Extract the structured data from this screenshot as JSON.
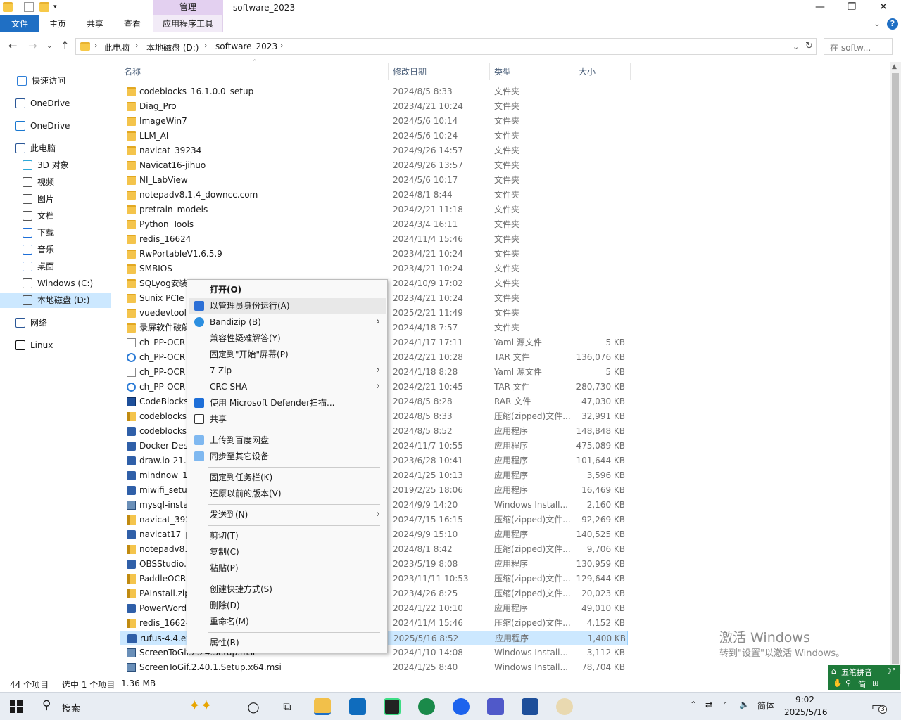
{
  "window": {
    "title": "software_2023",
    "context_tab_header": "管理",
    "controls": {
      "minimize": "—",
      "restore": "❐",
      "close": "✕"
    },
    "help": "?"
  },
  "ribbon": {
    "tabs": [
      "文件",
      "主页",
      "共享",
      "查看"
    ],
    "context_tab": "应用程序工具"
  },
  "address": {
    "crumbs": [
      "此电脑",
      "本地磁盘 (D:)",
      "software_2023"
    ],
    "search_placeholder": "在 softw..."
  },
  "nav": {
    "items": [
      {
        "label": "快速访问",
        "icon": "star-icon"
      },
      {
        "label": "OneDrive",
        "icon": "onedrive-icon"
      },
      {
        "label": "OneDrive",
        "icon": "cloud-icon"
      },
      {
        "label": "此电脑",
        "icon": "computer-icon"
      },
      {
        "label": "3D 对象",
        "icon": "3d-objects-icon"
      },
      {
        "label": "视频",
        "icon": "video-icon"
      },
      {
        "label": "图片",
        "icon": "pictures-icon"
      },
      {
        "label": "文档",
        "icon": "documents-icon"
      },
      {
        "label": "下载",
        "icon": "download-icon"
      },
      {
        "label": "音乐",
        "icon": "music-icon"
      },
      {
        "label": "桌面",
        "icon": "desktop-icon"
      },
      {
        "label": "Windows (C:)",
        "icon": "drive-c-icon"
      },
      {
        "label": "本地磁盘 (D:)",
        "icon": "drive-d-icon"
      },
      {
        "label": "网络",
        "icon": "network-icon"
      },
      {
        "label": "Linux",
        "icon": "linux-icon"
      }
    ]
  },
  "columns": {
    "name": "名称",
    "date": "修改日期",
    "type": "类型",
    "size": "大小"
  },
  "files": [
    {
      "name": "codeblocks_16.1.0.0_setup",
      "date": "2024/8/5 8:33",
      "type": "文件夹",
      "size": "",
      "icon": "folder"
    },
    {
      "name": "Diag_Pro",
      "date": "2023/4/21 10:24",
      "type": "文件夹",
      "size": "",
      "icon": "folder"
    },
    {
      "name": "ImageWin7",
      "date": "2024/5/6 10:14",
      "type": "文件夹",
      "size": "",
      "icon": "folder"
    },
    {
      "name": "LLM_AI",
      "date": "2024/5/6 10:24",
      "type": "文件夹",
      "size": "",
      "icon": "folder"
    },
    {
      "name": "navicat_39234",
      "date": "2024/9/26 14:57",
      "type": "文件夹",
      "size": "",
      "icon": "folder"
    },
    {
      "name": "Navicat16-jihuo",
      "date": "2024/9/26 13:57",
      "type": "文件夹",
      "size": "",
      "icon": "folder"
    },
    {
      "name": "NI_LabView",
      "date": "2024/5/6 10:17",
      "type": "文件夹",
      "size": "",
      "icon": "folder"
    },
    {
      "name": "notepadv8.1.4_downcc.com",
      "date": "2024/8/1 8:44",
      "type": "文件夹",
      "size": "",
      "icon": "folder"
    },
    {
      "name": "pretrain_models",
      "date": "2024/2/21 11:18",
      "type": "文件夹",
      "size": "",
      "icon": "folder"
    },
    {
      "name": "Python_Tools",
      "date": "2024/3/4 16:11",
      "type": "文件夹",
      "size": "",
      "icon": "folder"
    },
    {
      "name": "redis_16624",
      "date": "2024/11/4 15:46",
      "type": "文件夹",
      "size": "",
      "icon": "folder"
    },
    {
      "name": "RwPortableV1.6.5.9",
      "date": "2023/4/21 10:24",
      "type": "文件夹",
      "size": "",
      "icon": "folder"
    },
    {
      "name": "SMBIOS",
      "date": "2023/4/21 10:24",
      "type": "文件夹",
      "size": "",
      "icon": "folder"
    },
    {
      "name": "SQLyog安装",
      "date": "2024/10/9 17:02",
      "type": "文件夹",
      "size": "",
      "icon": "folder"
    },
    {
      "name": "Sunix PCIe",
      "date": "2023/4/21 10:24",
      "type": "文件夹",
      "size": "",
      "icon": "folder"
    },
    {
      "name": "vuedevtool",
      "date": "2025/2/21 11:49",
      "type": "文件夹",
      "size": "",
      "icon": "folder"
    },
    {
      "name": "录屏软件破解",
      "date": "2024/4/18 7:57",
      "type": "文件夹",
      "size": "",
      "icon": "folder"
    },
    {
      "name": "ch_PP-OCR",
      "date": "2024/1/17 17:11",
      "type": "Yaml 源文件",
      "size": "5 KB",
      "icon": "yaml"
    },
    {
      "name": "ch_PP-OCR",
      "date": "2024/2/21 10:28",
      "type": "TAR 文件",
      "size": "136,076 KB",
      "icon": "tar"
    },
    {
      "name": "ch_PP-OCR",
      "date": "2024/1/18 8:28",
      "type": "Yaml 源文件",
      "size": "5 KB",
      "icon": "yaml"
    },
    {
      "name": "ch_PP-OCR",
      "date": "2024/2/21 10:45",
      "type": "TAR 文件",
      "size": "280,730 KB",
      "icon": "tar"
    },
    {
      "name": "CodeBlocks",
      "date": "2024/8/5 8:28",
      "type": "RAR 文件",
      "size": "47,030 KB",
      "icon": "rar"
    },
    {
      "name": "codeblocks",
      "date": "2024/8/5 8:33",
      "type": "压缩(zipped)文件...",
      "size": "32,991 KB",
      "icon": "zip"
    },
    {
      "name": "codeblocks",
      "date": "2024/8/5 8:52",
      "type": "应用程序",
      "size": "148,848 KB",
      "icon": "exe"
    },
    {
      "name": "Docker Des",
      "date": "2024/11/7 10:55",
      "type": "应用程序",
      "size": "475,089 KB",
      "icon": "exe"
    },
    {
      "name": "draw.io-21.",
      "date": "2023/6/28 10:41",
      "type": "应用程序",
      "size": "101,644 KB",
      "icon": "exe"
    },
    {
      "name": "mindnow_1",
      "date": "2024/1/25 10:13",
      "type": "应用程序",
      "size": "3,596 KB",
      "icon": "exe"
    },
    {
      "name": "miwifi_setup",
      "date": "2019/2/25 18:06",
      "type": "应用程序",
      "size": "16,469 KB",
      "icon": "exe"
    },
    {
      "name": "mysql-insta",
      "date": "2024/9/9 14:20",
      "type": "Windows Install...",
      "size": "2,160 KB",
      "icon": "msi"
    },
    {
      "name": "navicat_392",
      "date": "2024/7/15 16:15",
      "type": "压缩(zipped)文件...",
      "size": "92,269 KB",
      "icon": "zip"
    },
    {
      "name": "navicat17_p",
      "date": "2024/9/9 15:10",
      "type": "应用程序",
      "size": "140,525 KB",
      "icon": "exe"
    },
    {
      "name": "notepadv8.",
      "date": "2024/8/1 8:42",
      "type": "压缩(zipped)文件...",
      "size": "9,706 KB",
      "icon": "zip"
    },
    {
      "name": "OBSStudio.",
      "date": "2023/5/19 8:08",
      "type": "应用程序",
      "size": "130,959 KB",
      "icon": "exe"
    },
    {
      "name": "PaddleOCR",
      "date": "2023/11/11 10:53",
      "type": "压缩(zipped)文件...",
      "size": "129,644 KB",
      "icon": "zip"
    },
    {
      "name": "PAInstall.zip",
      "date": "2023/4/26 8:25",
      "type": "压缩(zipped)文件...",
      "size": "20,023 KB",
      "icon": "zip"
    },
    {
      "name": "PowerWord",
      "date": "2024/1/22 10:10",
      "type": "应用程序",
      "size": "49,010 KB",
      "icon": "exe"
    },
    {
      "name": "redis_16624",
      "date": "2024/11/4 15:46",
      "type": "压缩(zipped)文件...",
      "size": "4,152 KB",
      "icon": "zip"
    },
    {
      "name": "rufus-4.4.exe",
      "date": "2025/5/16 8:52",
      "type": "应用程序",
      "size": "1,400 KB",
      "icon": "exe",
      "selected": true
    },
    {
      "name": "ScreenToGif.2.24.Setup.msi",
      "date": "2024/1/10 14:08",
      "type": "Windows Install...",
      "size": "3,112 KB",
      "icon": "msi"
    },
    {
      "name": "ScreenToGif.2.40.1.Setup.x64.msi",
      "date": "2024/1/25 8:40",
      "type": "Windows Install...",
      "size": "78,704 KB",
      "icon": "msi"
    }
  ],
  "context_menu": {
    "items": [
      {
        "label": "打开(O)",
        "bold": true
      },
      {
        "label": "以管理员身份运行(A)",
        "icon": "uac-shield-icon",
        "highlight": true
      },
      {
        "label": "Bandizip (B)",
        "icon": "bandizip-icon",
        "submenu": true
      },
      {
        "label": "兼容性疑难解答(Y)"
      },
      {
        "label": "固定到\"开始\"屏幕(P)"
      },
      {
        "label": "7-Zip",
        "submenu": true
      },
      {
        "label": "CRC SHA",
        "submenu": true
      },
      {
        "label": "使用 Microsoft Defender扫描...",
        "icon": "defender-icon"
      },
      {
        "label": "共享",
        "icon": "share-icon"
      },
      {
        "sep": true
      },
      {
        "label": "上传到百度网盘",
        "icon": "baidu-icon"
      },
      {
        "label": "同步至其它设备",
        "icon": "baidu-icon"
      },
      {
        "sep": true
      },
      {
        "label": "固定到任务栏(K)"
      },
      {
        "label": "还原以前的版本(V)"
      },
      {
        "sep": true
      },
      {
        "label": "发送到(N)",
        "submenu": true
      },
      {
        "sep": true
      },
      {
        "label": "剪切(T)"
      },
      {
        "label": "复制(C)"
      },
      {
        "label": "粘贴(P)"
      },
      {
        "sep": true
      },
      {
        "label": "创建快捷方式(S)"
      },
      {
        "label": "删除(D)"
      },
      {
        "label": "重命名(M)"
      },
      {
        "sep": true
      },
      {
        "label": "属性(R)"
      }
    ]
  },
  "status": {
    "count": "44 个项目",
    "selected": "选中 1 个项目",
    "size": "1.36 MB"
  },
  "watermark": {
    "line1": "激活 Windows",
    "line2": "转到\"设置\"以激活 Windows。"
  },
  "ime": {
    "line1": "五笔拼音",
    "line2": "简"
  },
  "taskbar": {
    "search": "搜索",
    "tray_lang": "简体",
    "time": "9:02",
    "date": "2025/5/16",
    "notifications": "3"
  }
}
